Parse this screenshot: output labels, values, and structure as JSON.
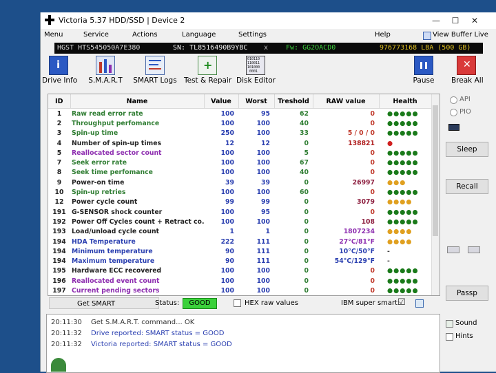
{
  "window": {
    "title": "Victoria 5.37 HDD/SSD | Device 2",
    "minimize": "—",
    "maximize": "☐",
    "close": "✕"
  },
  "menu": {
    "items": [
      "Menu",
      "Service",
      "Actions",
      "Language",
      "Settings",
      "Help"
    ],
    "view_buffer": "View Buffer Live"
  },
  "device": {
    "model": "HGST HTS545050A7E380",
    "serial": "SN: TL8516490B9YBC",
    "close": "x",
    "firmware": "Fw: GG2OACD0",
    "capacity": "976773168 LBA (500 GB)"
  },
  "toolbar": {
    "drive_info": "Drive Info",
    "smart": "S.M.A.R.T",
    "smart_logs": "SMART Logs",
    "test_repair": "Test & Repair",
    "disk_editor": "Disk Editor",
    "disk_editor_glyph": "010110\n110011\n101000\n0001",
    "pause": "Pause",
    "break_all": "Break All"
  },
  "smart_table": {
    "headers": [
      "ID",
      "Name",
      "Value",
      "Worst",
      "Treshold",
      "RAW value",
      "Health"
    ],
    "rows": [
      {
        "id": "1",
        "name": "Raw read error rate",
        "value": "100",
        "worst": "95",
        "thresh": "62",
        "raw": "0",
        "health": "●●●●●",
        "nc": "#2f7d32",
        "rc": "#c0392b",
        "hc": "#1a7a1a"
      },
      {
        "id": "2",
        "name": "Throughput perfomance",
        "value": "100",
        "worst": "100",
        "thresh": "40",
        "raw": "0",
        "health": "●●●●●",
        "nc": "#2f7d32",
        "rc": "#c0392b",
        "hc": "#1a7a1a"
      },
      {
        "id": "3",
        "name": "Spin-up time",
        "value": "250",
        "worst": "100",
        "thresh": "33",
        "raw": "5 / 0 / 0",
        "health": "●●●●●",
        "nc": "#2f7d32",
        "rc": "#c0392b",
        "hc": "#1a7a1a"
      },
      {
        "id": "4",
        "name": "Number of spin-up times",
        "value": "12",
        "worst": "12",
        "thresh": "0",
        "raw": "138821",
        "health": "●",
        "nc": "#222222",
        "rc": "#b02020",
        "hc": "#d02020"
      },
      {
        "id": "5",
        "name": "Reallocated sector count",
        "value": "100",
        "worst": "100",
        "thresh": "5",
        "raw": "0",
        "health": "●●●●●",
        "nc": "#8e2fb0",
        "rc": "#c0392b",
        "hc": "#1a7a1a"
      },
      {
        "id": "7",
        "name": "Seek error rate",
        "value": "100",
        "worst": "100",
        "thresh": "67",
        "raw": "0",
        "health": "●●●●●",
        "nc": "#2f7d32",
        "rc": "#c0392b",
        "hc": "#1a7a1a"
      },
      {
        "id": "8",
        "name": "Seek time perfomance",
        "value": "100",
        "worst": "100",
        "thresh": "40",
        "raw": "0",
        "health": "●●●●●",
        "nc": "#2f7d32",
        "rc": "#c0392b",
        "hc": "#1a7a1a"
      },
      {
        "id": "9",
        "name": "Power-on time",
        "value": "39",
        "worst": "39",
        "thresh": "0",
        "raw": "26997",
        "health": "●●●",
        "nc": "#222222",
        "rc": "#8e2040",
        "hc": "#e0a020"
      },
      {
        "id": "10",
        "name": "Spin-up retries",
        "value": "100",
        "worst": "100",
        "thresh": "60",
        "raw": "0",
        "health": "●●●●●",
        "nc": "#2f7d32",
        "rc": "#c0392b",
        "hc": "#1a7a1a"
      },
      {
        "id": "12",
        "name": "Power cycle count",
        "value": "99",
        "worst": "99",
        "thresh": "0",
        "raw": "3079",
        "health": "●●●●",
        "nc": "#222222",
        "rc": "#8e2040",
        "hc": "#e0a020"
      },
      {
        "id": "191",
        "name": "G-SENSOR shock counter",
        "value": "100",
        "worst": "95",
        "thresh": "0",
        "raw": "0",
        "health": "●●●●●",
        "nc": "#222222",
        "rc": "#c0392b",
        "hc": "#1a7a1a"
      },
      {
        "id": "192",
        "name": "Power Off Cycles count + Retract co...",
        "value": "100",
        "worst": "100",
        "thresh": "0",
        "raw": "108",
        "health": "●●●●●",
        "nc": "#222222",
        "rc": "#8e2040",
        "hc": "#1a7a1a"
      },
      {
        "id": "193",
        "name": "Load/unload cycle count",
        "value": "1",
        "worst": "1",
        "thresh": "0",
        "raw": "1807234",
        "health": "●●●●",
        "nc": "#222222",
        "rc": "#8e2fb0",
        "hc": "#e0a020"
      },
      {
        "id": "194",
        "name": "HDA Temperature",
        "value": "222",
        "worst": "111",
        "thresh": "0",
        "raw": "27°C/81°F",
        "health": "●●●●",
        "nc": "#2a3fb0",
        "rc": "#8e2fb0",
        "hc": "#e0a020"
      },
      {
        "id": "194",
        "name": "Minimum temperature",
        "value": "90",
        "worst": "111",
        "thresh": "0",
        "raw": "10°C/50°F",
        "health": "-",
        "nc": "#2a3fb0",
        "rc": "#2a3fb0",
        "hc": "#444444"
      },
      {
        "id": "194",
        "name": "Maximum temperature",
        "value": "90",
        "worst": "111",
        "thresh": "0",
        "raw": "54°C/129°F",
        "health": "-",
        "nc": "#2a3fb0",
        "rc": "#2a3fb0",
        "hc": "#444444"
      },
      {
        "id": "195",
        "name": "Hardware ECC recovered",
        "value": "100",
        "worst": "100",
        "thresh": "0",
        "raw": "0",
        "health": "●●●●●",
        "nc": "#222222",
        "rc": "#c0392b",
        "hc": "#1a7a1a"
      },
      {
        "id": "196",
        "name": "Reallocated event count",
        "value": "100",
        "worst": "100",
        "thresh": "0",
        "raw": "0",
        "health": "●●●●●",
        "nc": "#8e2fb0",
        "rc": "#c0392b",
        "hc": "#1a7a1a"
      },
      {
        "id": "197",
        "name": "Current pending sectors",
        "value": "100",
        "worst": "100",
        "thresh": "0",
        "raw": "0",
        "health": "●●●●●",
        "nc": "#8e2fb0",
        "rc": "#c0392b",
        "hc": "#1a7a1a"
      }
    ]
  },
  "status_bar": {
    "get_smart": "Get SMART",
    "status_label": "Status:",
    "status_value": "GOOD",
    "hex_raw": "HEX raw values",
    "ibm_super_smart": "IBM super smart:",
    "ibm_check": "☑"
  },
  "log": [
    {
      "time": "20:11:30",
      "text": "Get S.M.A.R.T. command... OK",
      "color": "#333333"
    },
    {
      "time": "20:11:32",
      "text": "Drive reported: SMART status = GOOD",
      "color": "#2a3fb0"
    },
    {
      "time": "20:11:32",
      "text": "Victoria reported: SMART status = GOOD",
      "color": "#2a3fb0"
    }
  ],
  "right_panel": {
    "api": "API",
    "pio": "PIO",
    "sleep": "Sleep",
    "recall": "Recall",
    "passp": "Passp",
    "sound": "Sound",
    "hints": "Hints"
  },
  "colors": {
    "status_good": "#3bd13b",
    "device_model": "#d8d8d8",
    "device_serial": "#f0f0f0",
    "device_fw": "#3dd23d",
    "device_lba": "#e0c020"
  }
}
